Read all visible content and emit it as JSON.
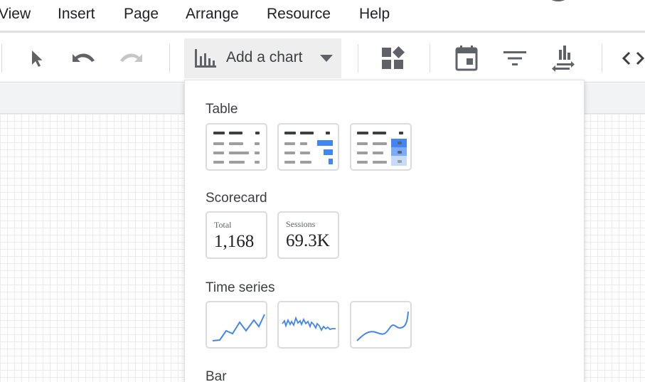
{
  "menubar": {
    "items": [
      "View",
      "Insert",
      "Page",
      "Arrange",
      "Resource",
      "Help"
    ]
  },
  "toolbar": {
    "add_chart_label": "Add a chart",
    "icons": [
      "select-pointer-icon",
      "undo-icon",
      "redo-icon",
      "bar-chart-icon",
      "dropdown-caret-icon",
      "community-visualizations-icon",
      "date-range-icon",
      "filter-control-icon",
      "data-control-icon",
      "embed-code-icon"
    ]
  },
  "dropdown": {
    "sections": {
      "table": {
        "title": "Table"
      },
      "scorecard": {
        "title": "Scorecard",
        "cards": [
          {
            "label": "Total",
            "value": "1,168"
          },
          {
            "label": "Sessions",
            "value": "69.3K"
          }
        ]
      },
      "time_series": {
        "title": "Time series"
      },
      "bar": {
        "title": "Bar"
      }
    }
  },
  "colors": {
    "accent": "#4285f4",
    "accent_light": "#aecbfa",
    "text": "#202124",
    "icon": "#5f6368",
    "border": "#dadce0"
  }
}
